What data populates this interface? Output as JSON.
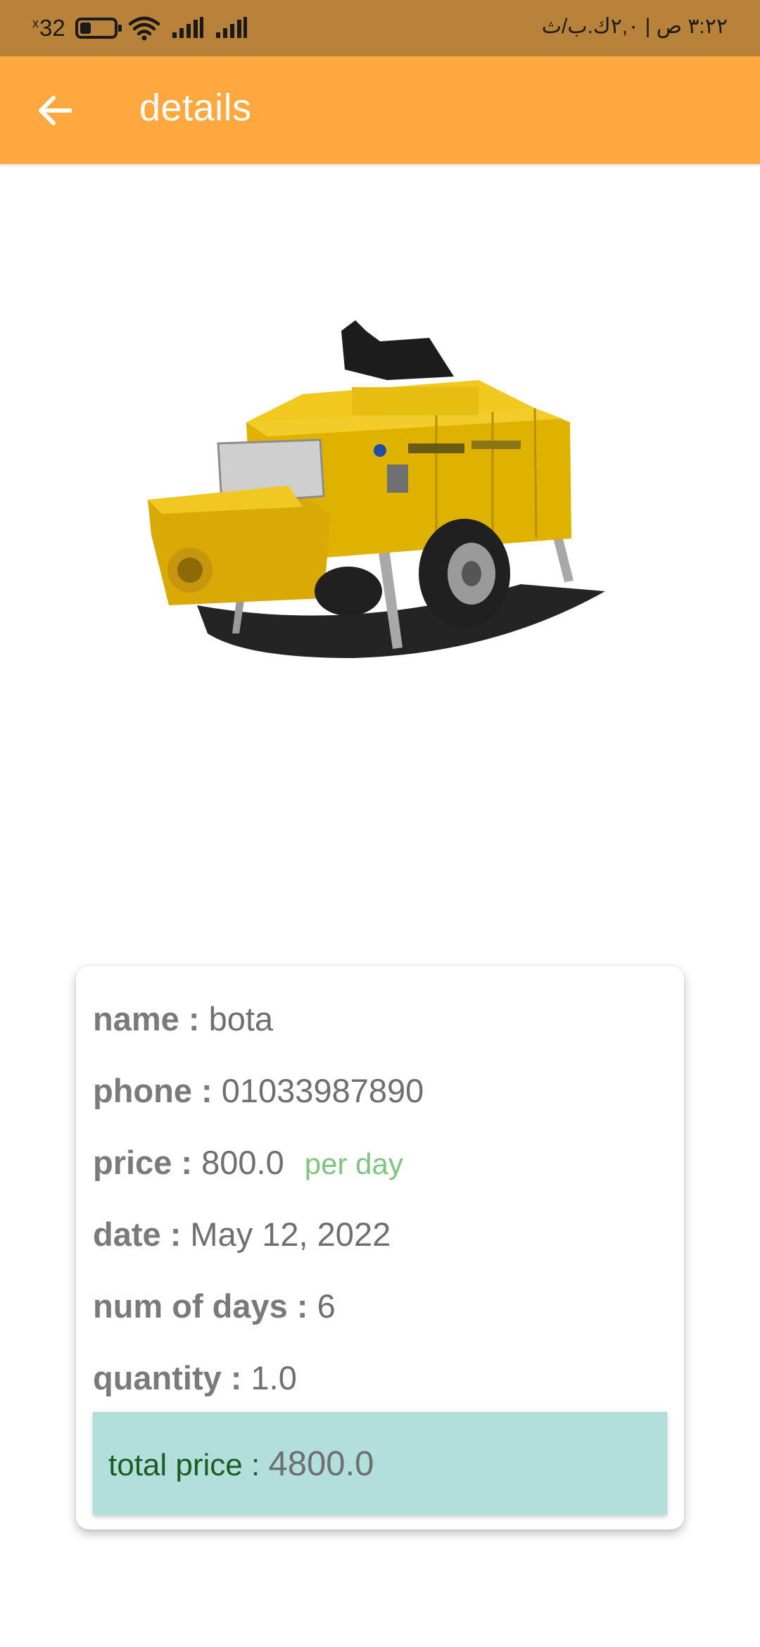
{
  "status_bar": {
    "battery_level": "32",
    "battery_fraction": 0.32,
    "time_text": "٣:٢٢ ص | ٢,٠ك.ب/ث"
  },
  "app_bar": {
    "title": "details",
    "back_icon": "arrow-back-icon",
    "color": "#fea83e"
  },
  "details": {
    "name_label": "name :",
    "name_value": "bota",
    "phone_label": "phone :",
    "phone_value": "01033987890",
    "price_label": "price :",
    "price_value": "800.0",
    "price_unit": "per day",
    "date_label": "date :",
    "date_value": "May 12, 2022",
    "days_label": "num of days :",
    "days_value": "6",
    "quantity_label": "quantity :",
    "quantity_value": "1.0",
    "total_label": "total price :",
    "total_value": "4800.0"
  },
  "colors": {
    "accent": "#fea83e",
    "status_bar": "#b8823a",
    "total_bg": "#b2dfdb",
    "total_label": "#1b5e20",
    "per_day": "#7fc481"
  }
}
